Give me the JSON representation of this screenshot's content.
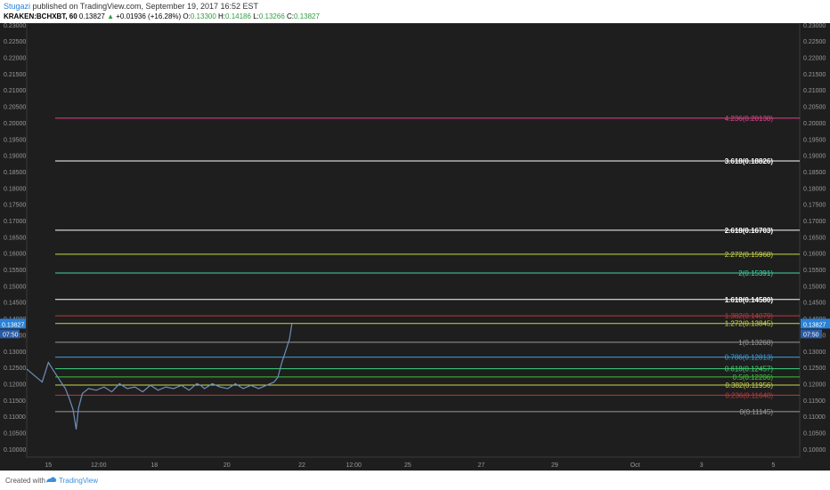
{
  "header": {
    "author": "Stugazi",
    "published_text": "published on TradingView.com, September 19, 2017 16:52 EST",
    "symbol": "KRAKEN:BCHXBT, 60",
    "last": "0.13827",
    "change_arrow": "▲",
    "change": "+0.01936 (+16.28%)",
    "o_label": "O:",
    "o_value": "0.13300",
    "h_label": "H:",
    "h_value": "0.14186",
    "l_label": "L:",
    "l_value": "0.13266",
    "c_label": "C:",
    "c_value": "0.13827"
  },
  "footer": {
    "created": "Created with",
    "brand": "TradingView"
  },
  "colors": {
    "background": "#1e1e1e",
    "candles": "#6f8fb8",
    "price_badge": "#2a82d8"
  },
  "price_badge": {
    "price": "0.13827",
    "time": "07:50"
  },
  "chart_data": {
    "type": "line",
    "ylim": [
      0.0975,
      0.2305
    ],
    "y_ticks": [
      "0.10000",
      "0.10500",
      "0.11000",
      "0.11500",
      "0.12000",
      "0.12500",
      "0.13000",
      "0.13500",
      "0.14000",
      "0.14500",
      "0.15000",
      "0.15500",
      "0.16000",
      "0.16500",
      "0.17000",
      "0.17500",
      "0.18000",
      "0.18500",
      "0.19000",
      "0.19500",
      "0.20000",
      "0.20500",
      "0.21000",
      "0.21500",
      "0.22000",
      "0.22500",
      "0.23000"
    ],
    "x_ticks": [
      {
        "label": "15",
        "pos": 0.028
      },
      {
        "label": "12:00",
        "pos": 0.093
      },
      {
        "label": "18",
        "pos": 0.165
      },
      {
        "label": "20",
        "pos": 0.259
      },
      {
        "label": "22",
        "pos": 0.356
      },
      {
        "label": "12:00",
        "pos": 0.423
      },
      {
        "label": "25",
        "pos": 0.493
      },
      {
        "label": "27",
        "pos": 0.588
      },
      {
        "label": "29",
        "pos": 0.683
      },
      {
        "label": "Oct",
        "pos": 0.787
      },
      {
        "label": "3",
        "pos": 0.873
      },
      {
        "label": "5",
        "pos": 0.966
      },
      {
        "label": "12:00",
        "pos": 1.03
      }
    ],
    "fib_levels": [
      {
        "label": "4.236(0.20138)",
        "value": 0.20138,
        "color": "#e0428c",
        "bold": false
      },
      {
        "label": "3.618(0.18826)",
        "value": 0.18826,
        "color": "#ffffff",
        "bold": true
      },
      {
        "label": "2.618(0.16703)",
        "value": 0.16703,
        "color": "#ffffff",
        "bold": true
      },
      {
        "label": "2.272(0.15968)",
        "value": 0.15968,
        "color": "#c8d84a",
        "bold": false
      },
      {
        "label": "2(0.15391)",
        "value": 0.15391,
        "color": "#3dd6a5",
        "bold": false
      },
      {
        "label": "1.618(0.14580)",
        "value": 0.1458,
        "color": "#ffffff",
        "bold": true
      },
      {
        "label": "1.382(0.14079)",
        "value": 0.14079,
        "color": "#c0393b",
        "bold": false
      },
      {
        "label": "1.272(0.13845)",
        "value": 0.13845,
        "color": "#c8d84a",
        "bold": false
      },
      {
        "label": "1(0.13268)",
        "value": 0.13268,
        "color": "#9a9a9a",
        "bold": false
      },
      {
        "label": "0.786(0.12813)",
        "value": 0.12813,
        "color": "#3d9fdc",
        "bold": false
      },
      {
        "label": "0.618(0.12457)",
        "value": 0.12457,
        "color": "#3dd67a",
        "bold": false
      },
      {
        "label": "0.5(0.12206)",
        "value": 0.12206,
        "color": "#3dc43d",
        "bold": false
      },
      {
        "label": "0.382(0.11956)",
        "value": 0.11956,
        "color": "#c8d84a",
        "bold": false
      },
      {
        "label": "0.236(0.11648)",
        "value": 0.11648,
        "color": "#c0393b",
        "bold": false
      },
      {
        "label": "0(0.11145)",
        "value": 0.11145,
        "color": "#9a9a9a",
        "bold": false
      }
    ],
    "series": [
      {
        "values": [
          [
            0.0,
            0.1245
          ],
          [
            0.01,
            0.1225
          ],
          [
            0.02,
            0.1205
          ],
          [
            0.028,
            0.1265
          ],
          [
            0.036,
            0.1235
          ],
          [
            0.043,
            0.121
          ],
          [
            0.05,
            0.1185
          ],
          [
            0.055,
            0.1155
          ],
          [
            0.06,
            0.112
          ],
          [
            0.064,
            0.106
          ],
          [
            0.067,
            0.1125
          ],
          [
            0.072,
            0.117
          ],
          [
            0.08,
            0.1185
          ],
          [
            0.09,
            0.118
          ],
          [
            0.1,
            0.119
          ],
          [
            0.11,
            0.1175
          ],
          [
            0.12,
            0.12
          ],
          [
            0.13,
            0.1185
          ],
          [
            0.14,
            0.119
          ],
          [
            0.15,
            0.1175
          ],
          [
            0.16,
            0.1195
          ],
          [
            0.17,
            0.118
          ],
          [
            0.18,
            0.119
          ],
          [
            0.19,
            0.1185
          ],
          [
            0.2,
            0.1195
          ],
          [
            0.21,
            0.118
          ],
          [
            0.22,
            0.12
          ],
          [
            0.225,
            0.1195
          ],
          [
            0.23,
            0.1185
          ],
          [
            0.24,
            0.12
          ],
          [
            0.25,
            0.119
          ],
          [
            0.26,
            0.1185
          ],
          [
            0.27,
            0.12
          ],
          [
            0.28,
            0.1185
          ],
          [
            0.29,
            0.1195
          ],
          [
            0.3,
            0.1185
          ],
          [
            0.31,
            0.1195
          ],
          [
            0.32,
            0.1205
          ],
          [
            0.325,
            0.122
          ],
          [
            0.33,
            0.1265
          ],
          [
            0.335,
            0.13
          ],
          [
            0.34,
            0.1338
          ],
          [
            0.343,
            0.1383
          ]
        ]
      }
    ]
  }
}
